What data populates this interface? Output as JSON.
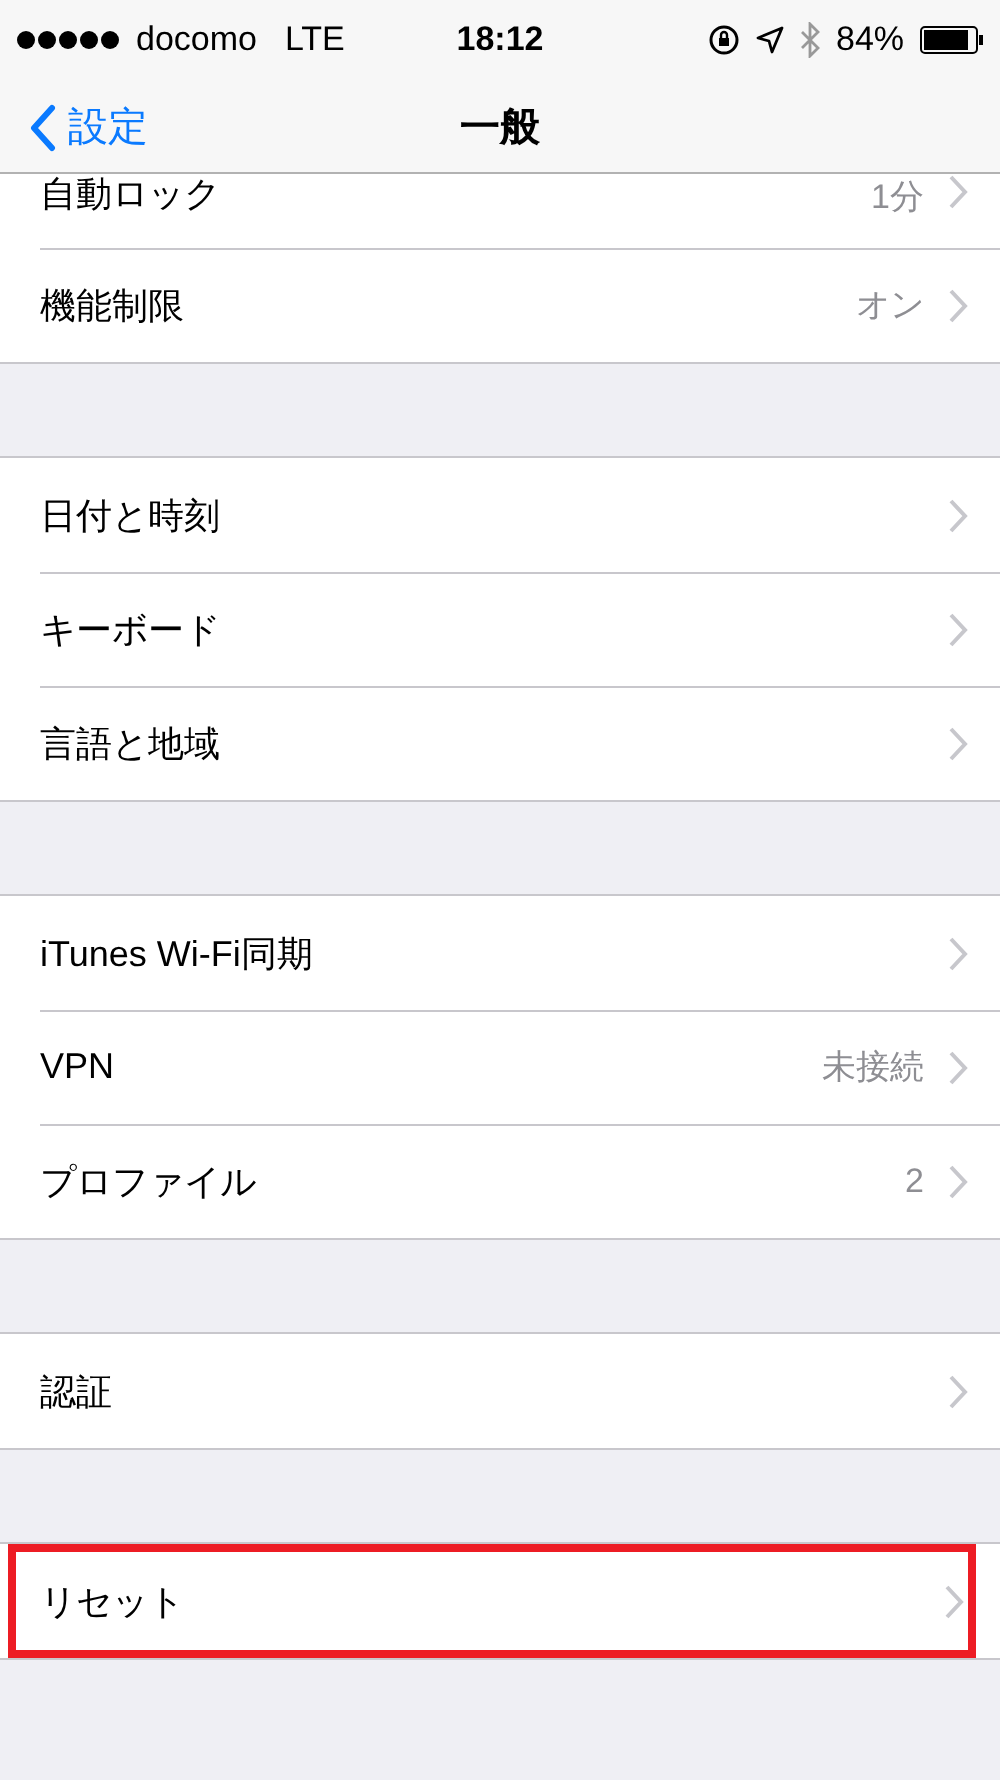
{
  "status_bar": {
    "carrier": "docomo",
    "network": "LTE",
    "time": "18:12",
    "battery": "84%"
  },
  "nav_bar": {
    "back": "設定",
    "title": "一般"
  },
  "groups": [
    {
      "items": [
        {
          "label": "自動ロック",
          "value": "1分",
          "highlighted": false,
          "clipped": true
        },
        {
          "label": "機能制限",
          "value": "オン",
          "highlighted": false,
          "clipped": false
        }
      ]
    },
    {
      "items": [
        {
          "label": "日付と時刻",
          "highlighted": false,
          "clipped": false
        },
        {
          "label": "キーボード",
          "highlighted": false,
          "clipped": false
        },
        {
          "label": "言語と地域",
          "highlighted": false,
          "clipped": false
        }
      ]
    },
    {
      "items": [
        {
          "label": "iTunes Wi-Fi同期",
          "highlighted": false,
          "clipped": false
        },
        {
          "label": "VPN",
          "value": "未接続",
          "highlighted": false,
          "clipped": false
        },
        {
          "label": "プロファイル",
          "value": "2",
          "highlighted": false,
          "clipped": false
        }
      ]
    },
    {
      "items": [
        {
          "label": "認証",
          "highlighted": false,
          "clipped": false
        }
      ]
    },
    {
      "items": [
        {
          "label": "リセット",
          "highlighted": true,
          "clipped": false
        }
      ]
    }
  ]
}
